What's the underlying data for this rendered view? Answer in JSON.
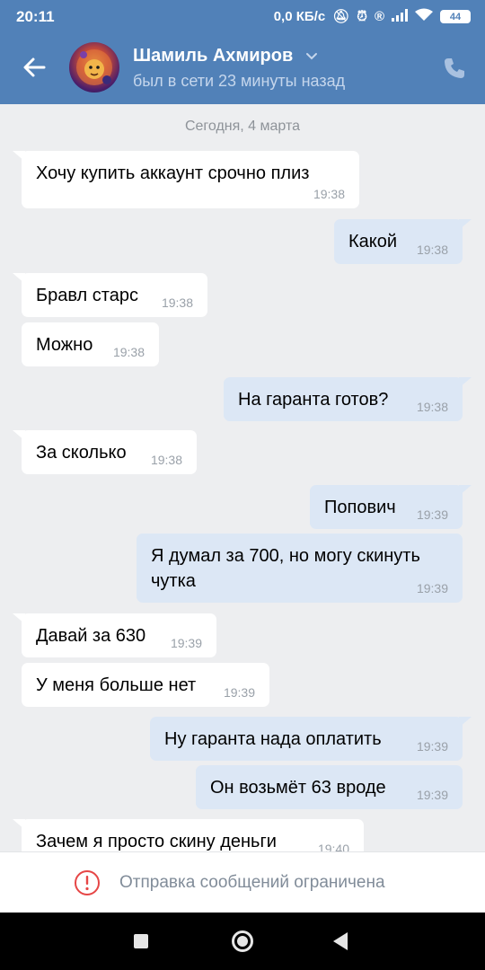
{
  "statusbar": {
    "time": "20:11",
    "speed": "0,0 КБ/с",
    "battery": "44",
    "icons": [
      "mute-icon",
      "alarm-icon",
      "registered-icon",
      "signal-icon",
      "wifi-icon",
      "battery-icon"
    ]
  },
  "header": {
    "name": "Шамиль Ахмиров",
    "status": "был в сети 23 минуты назад",
    "back_icon": "arrow-left-icon",
    "call_icon": "phone-icon"
  },
  "chat": {
    "date": "Сегодня, 4 марта",
    "messages": [
      {
        "dir": "in",
        "text": "Хочу купить аккаунт срочно плиз",
        "time": "19:38"
      },
      {
        "dir": "out",
        "text": "Какой",
        "time": "19:38"
      },
      {
        "dir": "in",
        "text": "Бравл старс",
        "time": "19:38"
      },
      {
        "dir": "in",
        "text": "Можно",
        "time": "19:38"
      },
      {
        "dir": "out",
        "text": "На гаранта готов?",
        "time": "19:38"
      },
      {
        "dir": "in",
        "text": "За сколько",
        "time": "19:38"
      },
      {
        "dir": "out",
        "text": "Попович",
        "time": "19:39"
      },
      {
        "dir": "out",
        "text_line1": "Я думал за 700, но могу скинуть",
        "text_line2": "чутка",
        "time": "19:39"
      },
      {
        "dir": "in",
        "text": "Давай за 630",
        "time": "19:39"
      },
      {
        "dir": "in",
        "text": "У меня больше нет",
        "time": "19:39"
      },
      {
        "dir": "out",
        "text": "Ну гаранта нада оплатить",
        "time": "19:39"
      },
      {
        "dir": "out",
        "text": "Он возьмёт 63 вроде",
        "time": "19:39"
      },
      {
        "dir": "in",
        "text": "Зачем я просто скину деньги",
        "time": "19:40"
      }
    ]
  },
  "bottom": {
    "restricted_text": "Отправка сообщений ограничена",
    "icon": "warning-icon"
  },
  "navbar": {
    "buttons": [
      "recents-button",
      "home-button",
      "back-button"
    ]
  }
}
